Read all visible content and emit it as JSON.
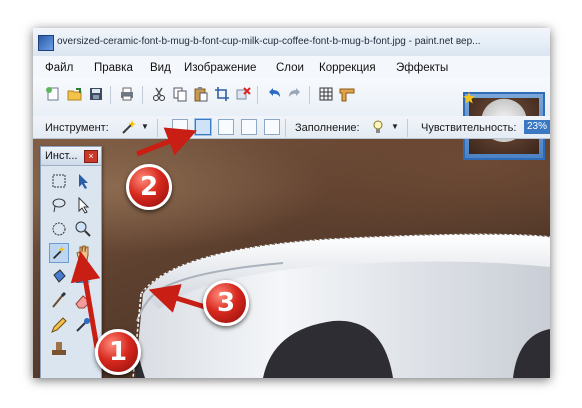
{
  "window": {
    "title": "oversized-ceramic-font-b-mug-b-font-cup-milk-cup-coffee-font-b-mug-b-font.jpg - paint.net вер..."
  },
  "menu": {
    "items": [
      "Файл",
      "Правка",
      "Вид",
      "Изображение",
      "Слои",
      "Коррекция",
      "Эффекты"
    ]
  },
  "options_bar": {
    "tool_label": "Инструмент:",
    "fill_label": "Заполнение:",
    "sensitivity_label": "Чувствительность:",
    "sensitivity_value": "23%"
  },
  "tools_window": {
    "title": "Инст..."
  },
  "callouts": [
    "1",
    "2",
    "3"
  ],
  "colors": {
    "callout": "#d7281e",
    "arrow": "#c81e14",
    "selection": "#3b78c2"
  },
  "icons": [
    "new-file-icon",
    "open-file-icon",
    "save-icon",
    "print-icon",
    "cut-icon",
    "copy-icon",
    "paste-icon",
    "crop-icon",
    "delete-icon",
    "undo-icon",
    "redo-icon",
    "grid-icon",
    "ruler-icon",
    "magic-wand-icon",
    "paint-bucket-icon",
    "rectangle-select-icon",
    "move-icon",
    "lasso-icon",
    "zoom-icon",
    "pan-hand-icon",
    "ellipse-select-icon",
    "paintbrush-icon",
    "eraser-icon",
    "pencil-icon",
    "recolor-icon",
    "clone-stamp-icon"
  ]
}
